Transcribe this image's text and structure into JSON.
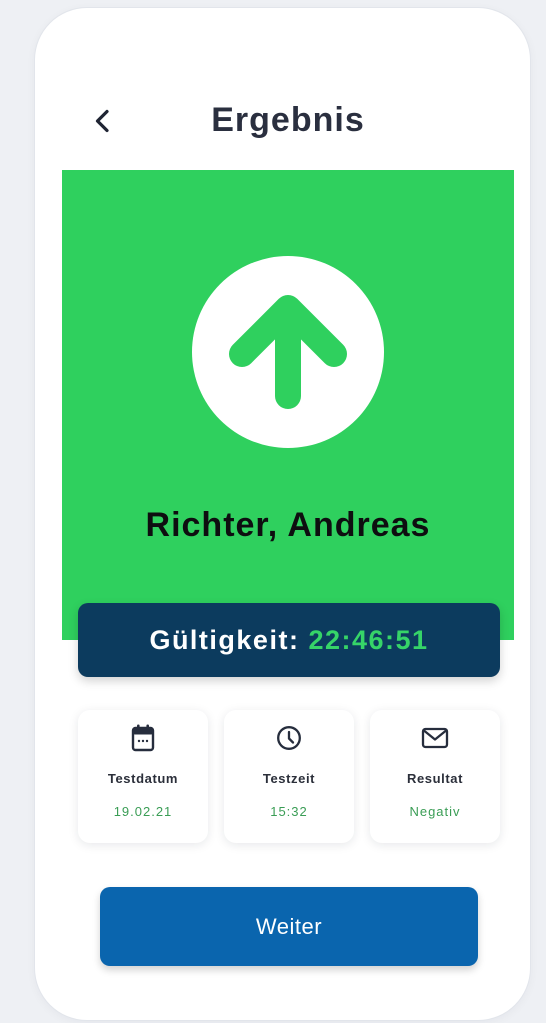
{
  "header": {
    "back_icon": "chevron-left-icon",
    "title": "Ergebnis"
  },
  "result": {
    "status_icon": "arrow-up-circle-icon",
    "name": "Richter, Andreas"
  },
  "validity": {
    "label": "Gültigkeit:",
    "value": "22:46:51"
  },
  "details": [
    {
      "icon": "calendar-icon",
      "label": "Testdatum",
      "value": "19.02.21"
    },
    {
      "icon": "clock-icon",
      "label": "Testzeit",
      "value": "15:32"
    },
    {
      "icon": "mail-icon",
      "label": "Resultat",
      "value": "Negativ"
    }
  ],
  "actions": {
    "continue_label": "Weiter"
  },
  "theme": {
    "result_green": "#2fd05e",
    "banner_navy": "#0c3b5e",
    "timer_green": "#36d468",
    "detail_value_green": "#3a9d55",
    "button_blue": "#0a65ae"
  }
}
